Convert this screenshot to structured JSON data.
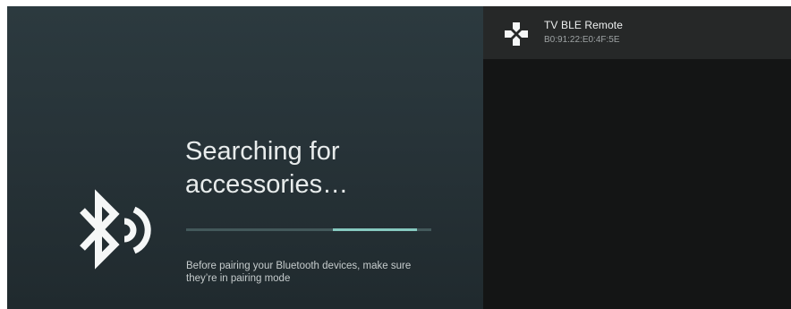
{
  "pairing": {
    "title_line1": "Searching for",
    "title_line2": "accessories…",
    "hint_line1": "Before pairing your Bluetooth devices, make sure",
    "hint_line2": "they’re in pairing mode",
    "progress": {
      "start_fraction": 0.6,
      "end_fraction": 0.94
    },
    "icon": "bluetooth-searching-icon"
  },
  "device_list": {
    "items": [
      {
        "name": "TV BLE Remote",
        "address": "B0:91:22:E0:4F:5E",
        "icon": "gamepad-icon"
      }
    ]
  },
  "colors": {
    "left_panel": "#273338",
    "right_panel": "#141515",
    "device_row": "#262828",
    "progress_track": "#43585a",
    "progress_fill": "#86c9bf",
    "text_primary": "#e8ecec"
  }
}
